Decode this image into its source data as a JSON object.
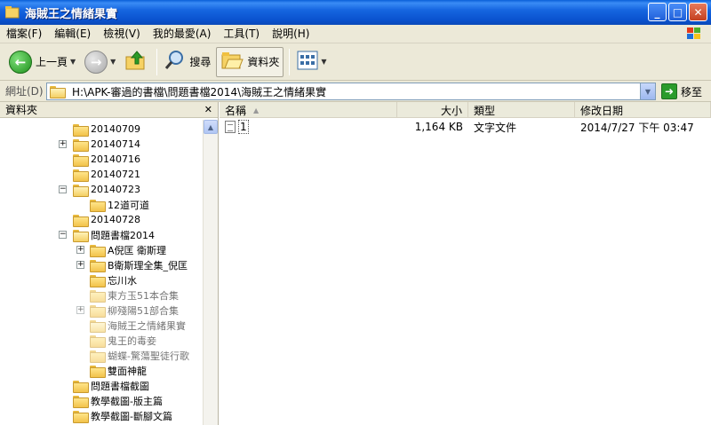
{
  "window": {
    "title": "海賊王之情緒果實"
  },
  "menu": [
    {
      "label": "檔案(F)"
    },
    {
      "label": "編輯(E)"
    },
    {
      "label": "檢視(V)"
    },
    {
      "label": "我的最愛(A)"
    },
    {
      "label": "工具(T)"
    },
    {
      "label": "說明(H)"
    }
  ],
  "toolbar": {
    "back_label": "上一頁",
    "search_label": "搜尋",
    "folders_label": "資料夾"
  },
  "address": {
    "label": "網址(D)",
    "path": "H:\\APK-審過的書檔\\問題書檔2014\\海賊王之情緒果實",
    "go_label": "移至"
  },
  "folder_pane": {
    "title": "資料夾",
    "items": [
      {
        "label": "20140709"
      },
      {
        "label": "20140714"
      },
      {
        "label": "20140716"
      },
      {
        "label": "20140721"
      },
      {
        "label": "20140723"
      },
      {
        "label": "12道可道"
      },
      {
        "label": "20140728"
      },
      {
        "label": "問題書檔2014"
      },
      {
        "label": "A倪匡 衛斯理"
      },
      {
        "label": "B衛斯理全集_倪匡"
      },
      {
        "label": "忘川水"
      },
      {
        "label": "東方玉51本合集"
      },
      {
        "label": "柳殘陽51部合集"
      },
      {
        "label": "海賊王之情緒果實"
      },
      {
        "label": "鬼王的毒妾"
      },
      {
        "label": "蝴蝶-驚蕩聖徒行歌"
      },
      {
        "label": "雙面神龍"
      },
      {
        "label": "問題書檔截圖"
      },
      {
        "label": "教學截圖-版主篇"
      },
      {
        "label": "教學截圖-斷腳文篇"
      }
    ]
  },
  "file_list": {
    "columns": {
      "name": "名稱",
      "size": "大小",
      "type": "類型",
      "date": "修改日期"
    },
    "rows": [
      {
        "name": "1",
        "size": "1,164 KB",
        "type": "文字文件",
        "date": "2014/7/27 下午 03:47"
      }
    ]
  }
}
